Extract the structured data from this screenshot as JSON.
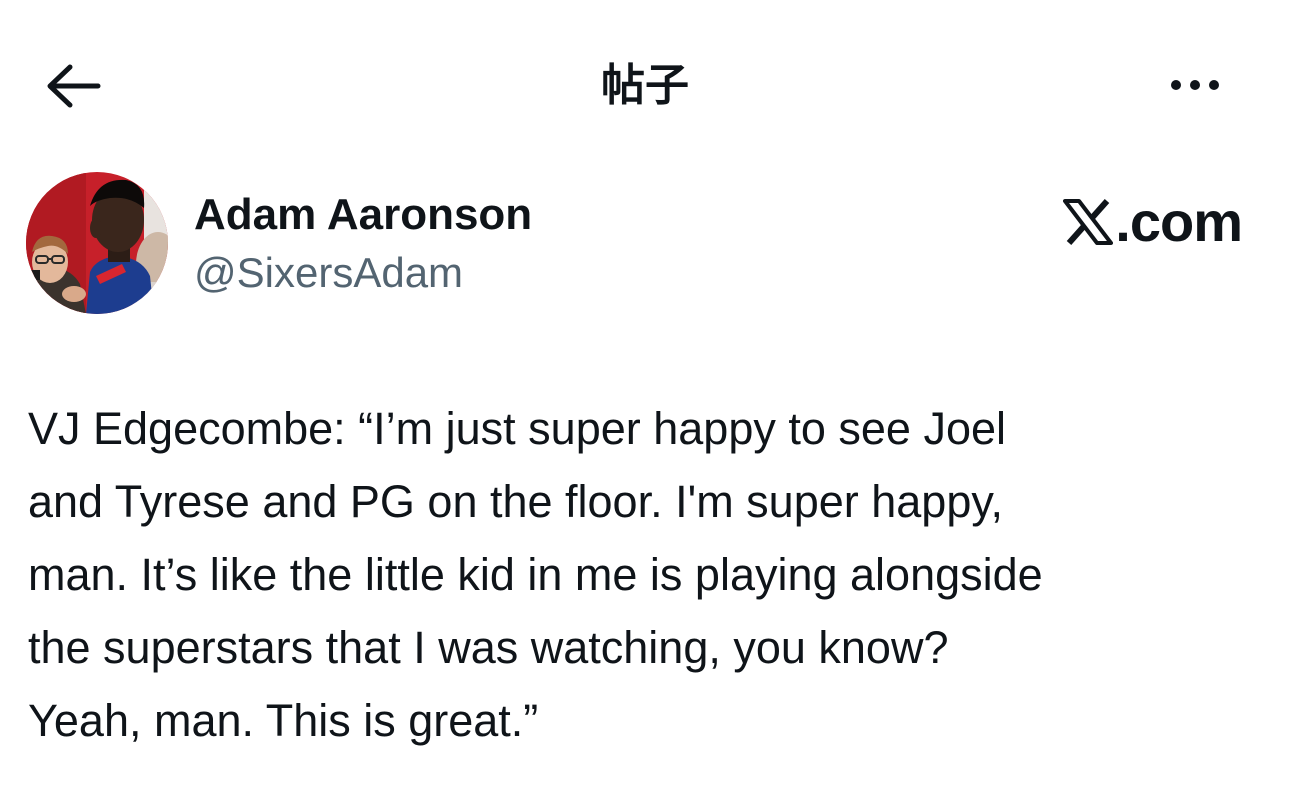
{
  "header": {
    "title": "帖子",
    "back_icon": "arrow-left-icon",
    "more_icon": "more-horizontal-icon"
  },
  "author": {
    "display_name": "Adam Aaronson",
    "handle": "@SixersAdam"
  },
  "brand": {
    "x_logo": "x-logo-icon",
    "domain_suffix": ".com"
  },
  "tweet": {
    "lines": [
      "VJ Edgecombe: “I’m just super happy to see Joel",
      "and Tyrese and PG on the floor. I'm super happy,",
      "man. It’s like the little kid in me is playing alongside",
      "the superstars that I was watching, you know?",
      "Yeah, man. This is great.”"
    ]
  },
  "colors": {
    "text_primary": "#0f1419",
    "text_secondary": "#536471",
    "background": "#ffffff"
  }
}
